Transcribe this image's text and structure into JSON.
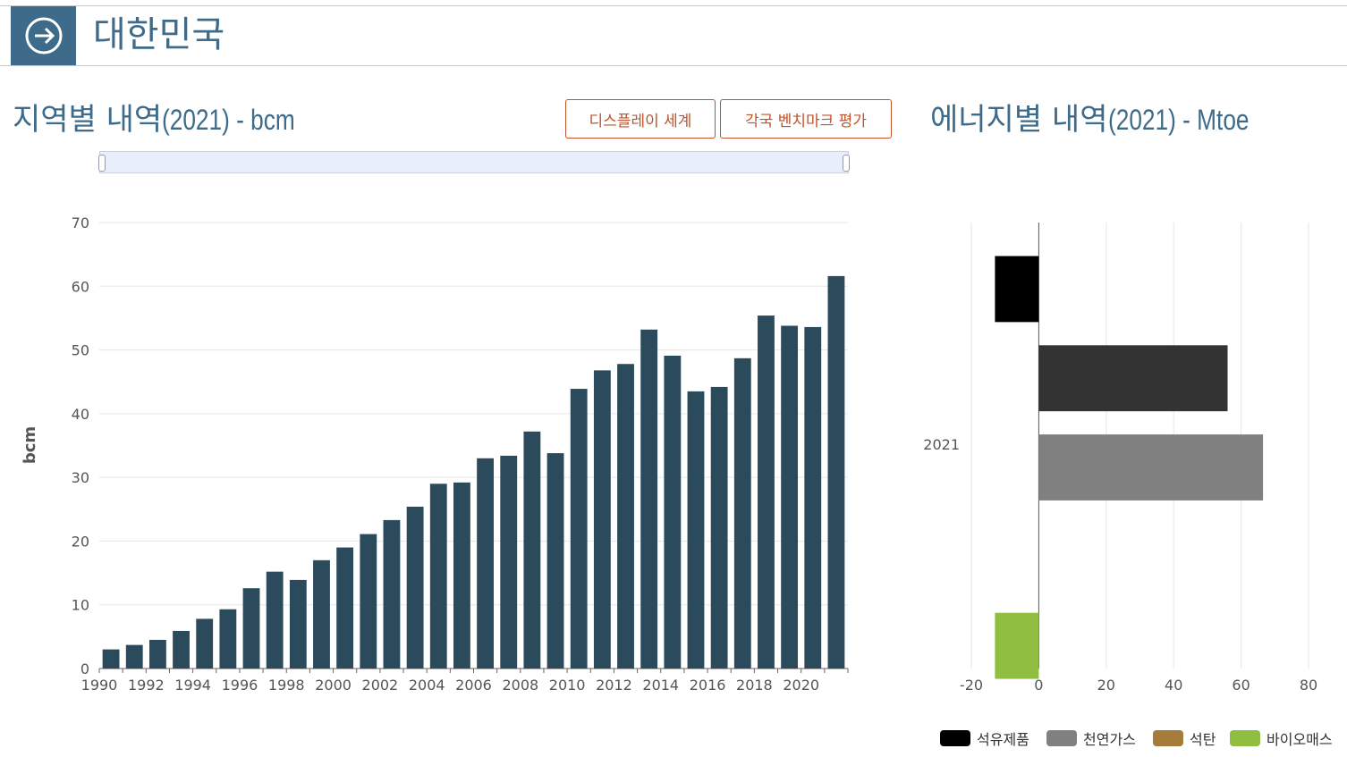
{
  "header": {
    "title": "대한민국",
    "icon": "arrow-right-circle-icon"
  },
  "left": {
    "title_main": "지역별 내역",
    "title_sub": " (2021) - bcm",
    "buttons": [
      "디스플레이 세계",
      "각국 벤치마크 평가"
    ]
  },
  "right": {
    "title_main": "에너지별 내역",
    "title_sub": " (2021) - Mtoe"
  },
  "legend": [
    {
      "label": "석유제품",
      "color": "#000000"
    },
    {
      "label": "천연가스",
      "color": "#808080"
    },
    {
      "label": "석탄",
      "color": "#a67c3d"
    },
    {
      "label": "바이오매스",
      "color": "#8fbe40"
    }
  ],
  "chart_data": [
    {
      "type": "bar",
      "ylabel": "bcm",
      "ylim": [
        0,
        70
      ],
      "yticks": [
        0,
        10,
        20,
        30,
        40,
        50,
        60,
        70
      ],
      "categories": [
        "1990",
        "1991",
        "1992",
        "1993",
        "1994",
        "1995",
        "1996",
        "1997",
        "1998",
        "1999",
        "2000",
        "2001",
        "2002",
        "2003",
        "2004",
        "2005",
        "2006",
        "2007",
        "2008",
        "2009",
        "2010",
        "2011",
        "2012",
        "2013",
        "2014",
        "2015",
        "2016",
        "2017",
        "2018",
        "2019",
        "2020",
        "2021"
      ],
      "xtick_labels": [
        "1990",
        "1992",
        "1994",
        "1996",
        "1998",
        "2000",
        "2002",
        "2004",
        "2006",
        "2008",
        "2010",
        "2012",
        "2014",
        "2016",
        "2018",
        "2020"
      ],
      "values": [
        3.0,
        3.7,
        4.5,
        5.9,
        7.8,
        9.3,
        12.6,
        15.2,
        13.9,
        17.0,
        19.0,
        21.1,
        23.3,
        25.4,
        29.0,
        29.2,
        33.0,
        33.4,
        37.2,
        33.8,
        43.9,
        46.8,
        47.8,
        53.2,
        49.1,
        43.5,
        44.2,
        48.7,
        55.4,
        53.8,
        53.6,
        61.6
      ],
      "color": "#2b4a5c",
      "grid": true
    },
    {
      "type": "bar",
      "orientation": "horizontal",
      "categories": [
        "2021"
      ],
      "xlim": [
        -20,
        80
      ],
      "xticks": [
        -20,
        0,
        20,
        40,
        60,
        80
      ],
      "series": [
        {
          "name": "석유제품",
          "values": [
            -13
          ],
          "color": "#000000"
        },
        {
          "name": "",
          "values": [
            56
          ],
          "color": "#333333"
        },
        {
          "name": "천연가스",
          "values": [
            66.5
          ],
          "color": "#808080"
        },
        {
          "name": "석탄",
          "values": [
            0
          ],
          "color": "#a67c3d"
        },
        {
          "name": "바이오매스",
          "values": [
            -13
          ],
          "color": "#8fbe40"
        }
      ],
      "grid": true
    }
  ]
}
